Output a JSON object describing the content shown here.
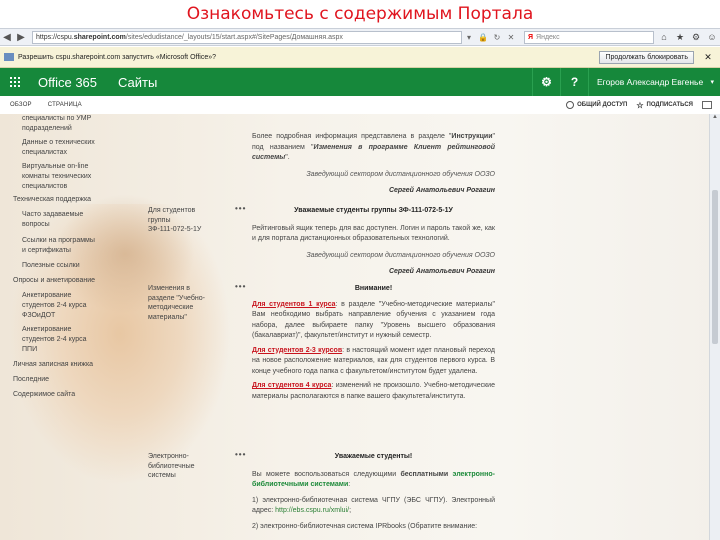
{
  "slide_title": "Ознакомьтесь с содержимым Портала",
  "browser": {
    "url_prefix": "https://cspu.",
    "url_domain": "sharepoint.com",
    "url_rest": "/sites/edudistance/_layouts/15/start.aspx#/SitePages/Домашняя.aspx",
    "search_brand": "Я",
    "search_placeholder": "Яндекс",
    "infobar_text": "Разрешить cspu.sharepoint.com запустить «Microsoft Office»?",
    "infobar_button": "Продолжать блокировать"
  },
  "suitebar": {
    "brand": "Office 365",
    "app": "Сайты",
    "user": "Егоров Александр Евгенье"
  },
  "ribbon": {
    "tab_browse": "ОБЗОР",
    "tab_page": "СТРАНИЦА",
    "share": "ОБЩИЙ ДОСТУП",
    "follow": "ПОДПИСАТЬСЯ"
  },
  "leftnav": {
    "item_0": "специалисты по УМР\nподразделений",
    "item_1": "Данные о технических\nспециалистах",
    "item_2": "Виртуальные on-line\nкомнаты технических\nспециалистов",
    "item_3": "Техническая поддержка",
    "item_4": "Часто задаваемые\nвопросы",
    "item_5": "Ссылки на программы\nи сертификаты",
    "item_6": "Полезные ссылки",
    "item_7": "Опросы и анкетирование",
    "item_8": "Анкетирование\nстудентов 2-4 курса\nФЗОиДОТ",
    "item_9": "Анкетирование\nстудентов 2-4 курса\nППИ",
    "item_10": "Личная записная книжка",
    "item_11": "Последние",
    "item_12": "Содержимое сайта"
  },
  "rows": {
    "row1_label": "Для студентов\nгруппы\nЗФ-111-072-5-1У",
    "row2_label": "Изменения в\nразделе \"Учебно-\nметодические\nматериалы\"",
    "row3_label": "Электронно-\nбиблиотечные\nсистемы",
    "dots": "•••"
  },
  "post0": {
    "p1_a": "Более подробная информация представлена в разделе \"",
    "p1_b": "Инструкции",
    "p1_c": "\" под названием \"",
    "p1_d": "Изменения в программе Клиент рейтинговой системы",
    "p1_e": "\".",
    "sig_role": "Заведующий сектором дистанционного обучения ООЗО",
    "sig_name": "Сергей Анатольевич Рогагин"
  },
  "post1": {
    "heading": "Уважаемые студенты группы ЗФ-111-072-5-1У",
    "body": "Рейтинговый ящик теперь для вас доступен. Логин и пароль такой же, как и для портала дистанционных образовательных технологий.",
    "sig_role": "Заведующий сектором дистанционного обучения ООЗО",
    "sig_name": "Сергей Анатольевич Рогагин"
  },
  "post2": {
    "heading": "Внимание!",
    "c1_red": "Для студентов 1 курса",
    "c1_text": ": в разделе \"Учебно-методические материалы\" Вам необходимо выбрать направление обучения с указанием года набора, далее выбираете папку \"Уровень высшего образования (бакалавриат)\", факультет/институт и нужный семестр.",
    "c2_red": "Для студентов 2-3 курсов",
    "c2_text": ": в настоящий момент идет плановый переход на новое расположение материалов, как для студентов первого курса. В конце учебного года папка с факультетом/институтом будет удалена.",
    "c3_red": "Для студентов 4 курса",
    "c3_text": ": изменений не произошло. Учебно-методические материалы располагаются в папке вашего факультета/института."
  },
  "post3": {
    "heading": "Уважаемые студенты!",
    "intro_a": "Вы можете воспользоваться следующими ",
    "intro_b": "бесплатными",
    "intro_c": " электронно-библиотечными системами",
    "intro_d": ":",
    "item1_a": "1) электронно-библиотечная система ЧГПУ (ЭБС ЧГПУ). Электронный адрес: ",
    "item1_link": "http://ebs.cspu.ru/xmlui/",
    "item1_b": ";",
    "item2": "2) электронно-библиотечная система IPRbooks (Обратите внимание:"
  }
}
